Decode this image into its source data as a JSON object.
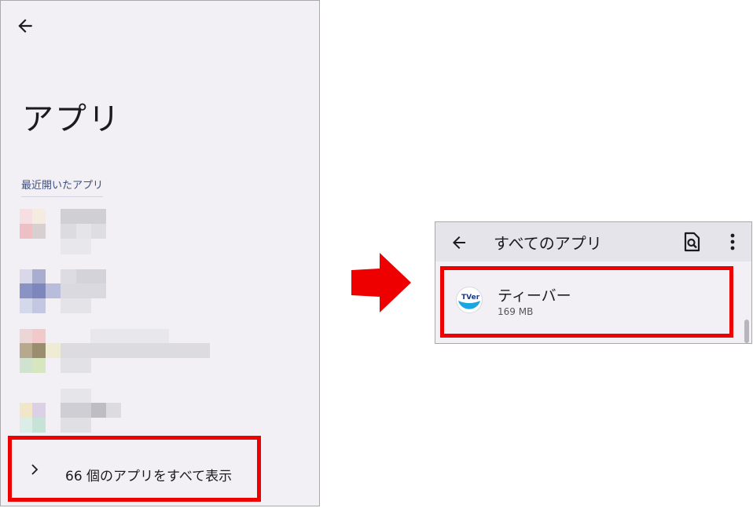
{
  "left": {
    "page_title": "アプリ",
    "section_header": "最近開いたアプリ",
    "show_all_label": "66 個のアプリをすべて表示"
  },
  "right": {
    "title": "すべてのアプリ",
    "app": {
      "name": "ティーバー",
      "size": "169 MB",
      "icon_text": "TVer"
    }
  },
  "colors": {
    "highlight": "#ee0000",
    "background": "#f2f0f5",
    "header": "#e6e4eb",
    "accent_text": "#3d4f7d"
  },
  "icons": [
    "back-arrow-icon",
    "chevron-right-icon",
    "search-app-icon",
    "more-vert-icon",
    "tver-app-icon",
    "red-arrow-icon"
  ]
}
